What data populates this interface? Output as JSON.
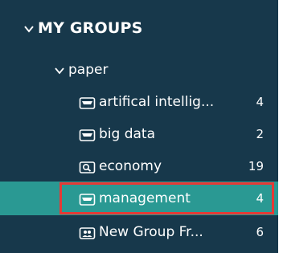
{
  "header": {
    "label": "MY GROUPS",
    "chevron_icon": "chevron-down-icon"
  },
  "folder": {
    "label": "paper",
    "chevron_icon": "chevron-down-icon"
  },
  "groups": [
    {
      "label": "artifical intellig...",
      "count": "4",
      "icon": "smart-group-icon"
    },
    {
      "label": "big data",
      "count": "2",
      "icon": "smart-group-icon"
    },
    {
      "label": "economy",
      "count": "19",
      "icon": "search-group-icon"
    },
    {
      "label": "management",
      "count": "4",
      "icon": "smart-group-icon",
      "selected": true
    },
    {
      "label": "New Group Fr...",
      "count": "6",
      "icon": "shared-group-icon"
    }
  ],
  "colors": {
    "panel_background": "#17384b",
    "selected_background": "#2a9993",
    "highlight_border": "#e53935",
    "text": "#ffffff"
  }
}
